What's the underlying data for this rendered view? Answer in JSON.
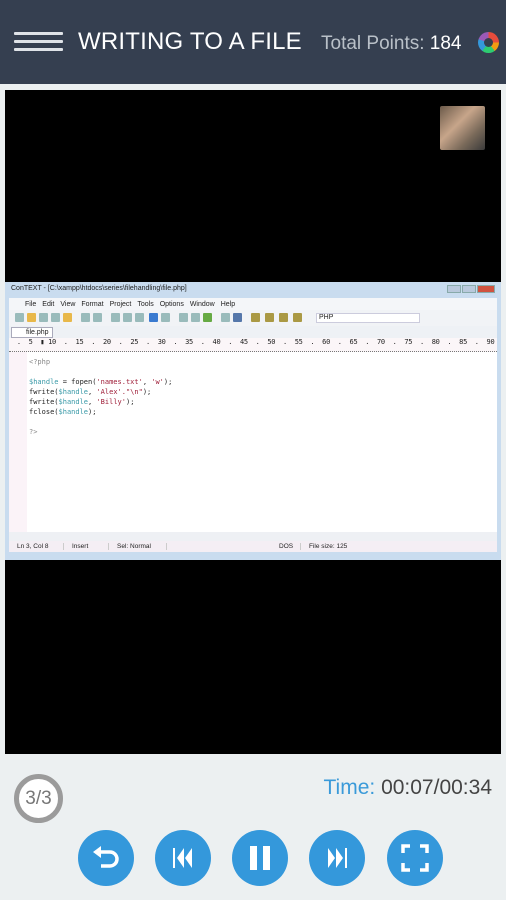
{
  "header": {
    "title": "WRITING TO A FILE",
    "points_label": "Total Points:",
    "points_value": "184"
  },
  "screen": {
    "window_title": "ConTEXT - [C:\\xampp\\htdocs\\series\\filehandling\\file.php]",
    "menu": [
      "File",
      "Edit",
      "View",
      "Format",
      "Project",
      "Tools",
      "Options",
      "Window",
      "Help"
    ],
    "language": "PHP",
    "tab": "file.php",
    "ruler": "  .  5  ▮ 10  .  15  .  20  .  25  .  30  .  35  .  40  .  45  .  50  .  55  .  60  .  65  .  70  .  75  .  80  .  85  .  90  .  95  . 10",
    "code": {
      "open": "<?php",
      "l1a": "$handle",
      "l1b": " = fopen(",
      "l1c": "'names.txt'",
      "l1d": ", ",
      "l1e": "'w'",
      "l1f": ");",
      "l2a": "fwrite(",
      "l2b": "$handle",
      "l2c": ", ",
      "l2d": "'Alex'.\"\\n\"",
      "l2e": ");",
      "l3a": "fwrite(",
      "l3b": "$handle",
      "l3c": ", ",
      "l3d": "'Billy'",
      "l3e": ");",
      "l4a": "fclose(",
      "l4b": "$handle",
      "l4c": ");",
      "close": "?>"
    },
    "status": [
      "Ln 3, Col 8",
      "Insert",
      "Sel: Normal",
      "",
      "",
      "DOS",
      "File size: 125"
    ]
  },
  "footer": {
    "counter": "3/3",
    "time_label": "Time:",
    "time_value": "00:07/00:34"
  },
  "controls": [
    "replay-icon",
    "skip-back-icon",
    "pause-icon",
    "skip-forward-icon",
    "fullscreen-icon"
  ],
  "colors": {
    "header": "#353f50",
    "accent": "#3498db",
    "background": "#ecf0f1"
  }
}
